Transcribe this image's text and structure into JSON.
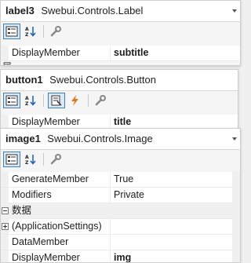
{
  "panels": [
    {
      "object_name": "label3",
      "object_type": "Swebui.Controls.Label",
      "rows": [
        {
          "name": "DisplayMember",
          "value": "subtitle",
          "bold": true
        }
      ],
      "partial_text": "属"
    },
    {
      "object_name": "button1",
      "object_type": "Swebui.Controls.Button",
      "rows": [
        {
          "name": "DisplayMember",
          "value": "title",
          "bold": true
        }
      ]
    },
    {
      "object_name": "image1",
      "object_type": "Swebui.Controls.Image",
      "rows": [
        {
          "name": "GenerateMember",
          "value": "True"
        },
        {
          "name": "Modifiers",
          "value": "Private"
        },
        {
          "category": "数据"
        },
        {
          "name": "(ApplicationSettings)",
          "value": "",
          "expandable": true
        },
        {
          "name": "DataMember",
          "value": ""
        },
        {
          "name": "DisplayMember",
          "value": "img",
          "bold": true
        }
      ]
    }
  ],
  "icons": {
    "categorized": "categorized-icon",
    "alphabetical": "alphabetical-icon",
    "properties": "properties-icon",
    "events": "events-icon",
    "property_pages": "wrench-icon"
  }
}
